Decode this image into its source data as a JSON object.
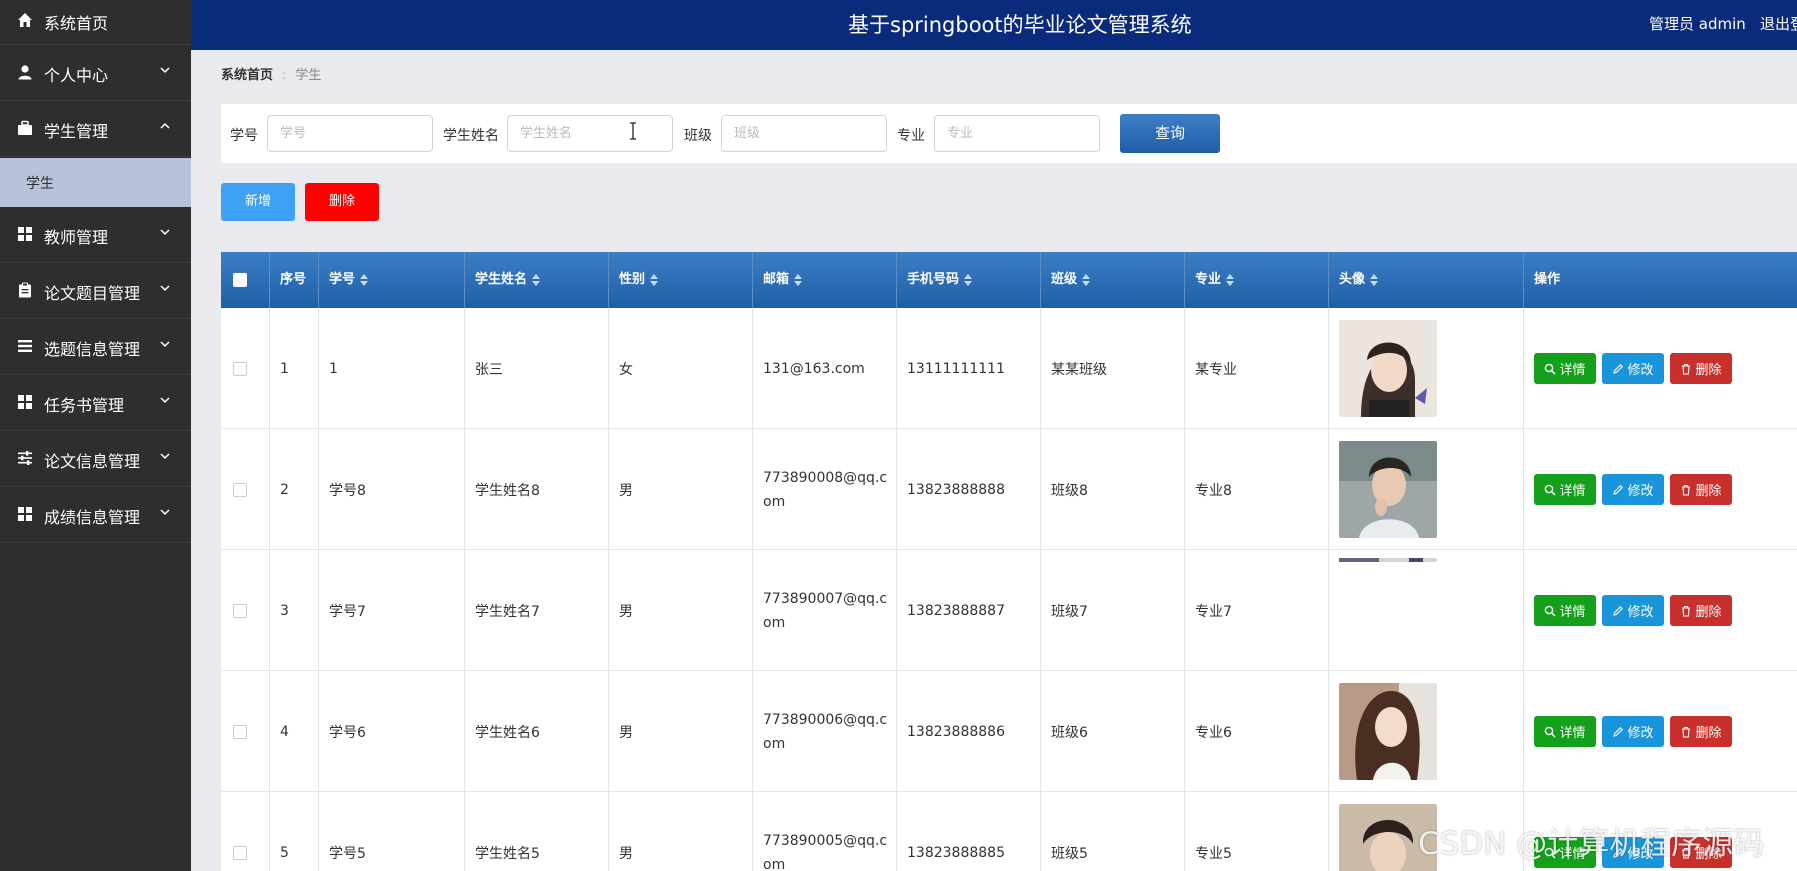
{
  "app": {
    "title": "基于springboot的毕业论文管理系统",
    "user": "管理员 admin",
    "logout": "退出登"
  },
  "sidebar": {
    "items": [
      {
        "label": "系统首页",
        "icon": "home-icon"
      },
      {
        "label": "个人中心",
        "icon": "user-icon",
        "expand": "chevron-down"
      },
      {
        "label": "学生管理",
        "icon": "briefcase-icon",
        "expand": "chevron-up"
      },
      {
        "label": "教师管理",
        "icon": "grid-icon",
        "expand": "chevron-down"
      },
      {
        "label": "论文题目管理",
        "icon": "clipboard-icon",
        "expand": "chevron-down"
      },
      {
        "label": "选题信息管理",
        "icon": "list-icon",
        "expand": "chevron-down"
      },
      {
        "label": "任务书管理",
        "icon": "grid-icon",
        "expand": "chevron-down"
      },
      {
        "label": "论文信息管理",
        "icon": "sliders-icon",
        "expand": "chevron-down"
      },
      {
        "label": "成绩信息管理",
        "icon": "grid-icon",
        "expand": "chevron-down"
      }
    ],
    "submenu": {
      "label": "学生"
    }
  },
  "breadcrumb": {
    "home": "系统首页",
    "current": "学生"
  },
  "search": {
    "fields": [
      {
        "label": "学号",
        "placeholder": "学号"
      },
      {
        "label": "学生姓名",
        "placeholder": "学生姓名"
      },
      {
        "label": "班级",
        "placeholder": "班级"
      },
      {
        "label": "专业",
        "placeholder": "专业"
      }
    ],
    "query_label": "查询"
  },
  "actions": {
    "add": "新增",
    "delete": "删除"
  },
  "table": {
    "headers": [
      "序号",
      "学号",
      "学生姓名",
      "性别",
      "邮箱",
      "手机号码",
      "班级",
      "专业",
      "头像",
      "操作"
    ],
    "row_buttons": {
      "detail": "详情",
      "edit": "修改",
      "delete": "删除"
    },
    "rows": [
      {
        "idx": "1",
        "xuehao": "1",
        "name": "张三",
        "gender": "女",
        "email": "131@163.com",
        "phone": "13111111111",
        "class": "某某班级",
        "major": "某专业",
        "avatar": "female-portrait"
      },
      {
        "idx": "2",
        "xuehao": "学号8",
        "name": "学生姓名8",
        "gender": "男",
        "email": "773890008@qq.com",
        "phone": "13823888888",
        "class": "班级8",
        "major": "专业8",
        "avatar": "male-portrait"
      },
      {
        "idx": "3",
        "xuehao": "学号7",
        "name": "学生姓名7",
        "gender": "男",
        "email": "773890007@qq.com",
        "phone": "13823888887",
        "class": "班级7",
        "major": "专业7",
        "avatar": "broken-image"
      },
      {
        "idx": "4",
        "xuehao": "学号6",
        "name": "学生姓名6",
        "gender": "男",
        "email": "773890006@qq.com",
        "phone": "13823888886",
        "class": "班级6",
        "major": "专业6",
        "avatar": "female-portrait"
      },
      {
        "idx": "5",
        "xuehao": "学号5",
        "name": "学生姓名5",
        "gender": "男",
        "email": "773890005@qq.com",
        "phone": "13823888885",
        "class": "班级5",
        "major": "专业5",
        "avatar": "male-portrait"
      }
    ]
  },
  "watermark": "CSDN @计算机程序源码",
  "colors": {
    "sidebar": "#2e2e2e",
    "topbar": "#0a2a7c",
    "submenu_active": "#b8c3db",
    "table_header": "#2a6cb4",
    "add": "#3fa1f5",
    "delete": "#ff0000",
    "detail": "#14a01a",
    "edit": "#1995dc",
    "row_delete": "#c9302c"
  }
}
